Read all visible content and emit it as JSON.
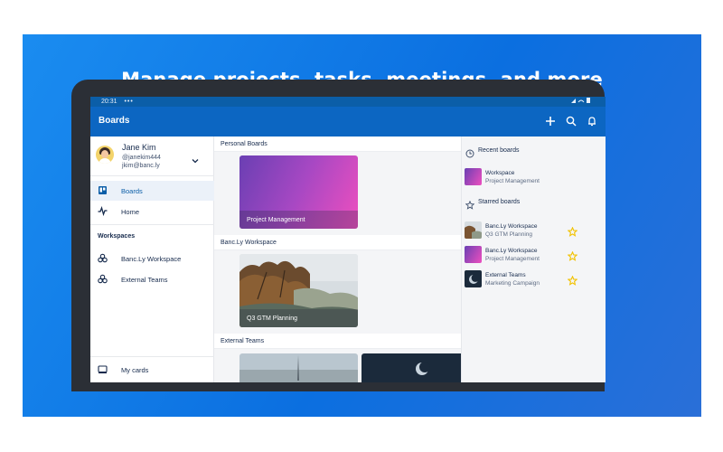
{
  "headline": "Manage projects, tasks, meetings, and more",
  "status_bar": {
    "time": "20:31",
    "dots": "•••"
  },
  "app_bar": {
    "title": "Boards"
  },
  "user": {
    "name": "Jane Kim",
    "handle": "@janekim444",
    "email": "jkim@banc.ly"
  },
  "nav": {
    "boards": "Boards",
    "home": "Home",
    "workspaces_title": "Workspaces",
    "workspaces": [
      "Banc.Ly Workspace",
      "External Teams"
    ],
    "my_cards": "My cards"
  },
  "sections": {
    "personal": "Personal Boards",
    "banc": "Banc.Ly Workspace",
    "external": "External Teams"
  },
  "boards": {
    "project_management": "Project Management",
    "q3_planning": "Q3 GTM Planning"
  },
  "right": {
    "recent_title": "Recent boards",
    "recent": [
      {
        "line1": "Workspace",
        "line2": "Project Management"
      }
    ],
    "starred_title": "Starred boards",
    "starred": [
      {
        "line1": "Banc.Ly Workspace",
        "line2": "Q3 GTM Planning"
      },
      {
        "line1": "Banc.Ly Workspace",
        "line2": "Project Management"
      },
      {
        "line1": "External Teams",
        "line2": "Marketing Campaign"
      }
    ]
  },
  "colors": {
    "banner_blue": "#0b6fe0",
    "app_bar": "#0c66c2",
    "gradient_start": "#6a3fb3",
    "gradient_end": "#ee4fbf",
    "star": "#f2c200"
  },
  "icons": [
    "plus-icon",
    "search-icon",
    "bell-icon",
    "chevron-down-icon",
    "board-icon",
    "activity-icon",
    "workspace-icon",
    "card-icon",
    "clock-icon",
    "star-icon"
  ]
}
